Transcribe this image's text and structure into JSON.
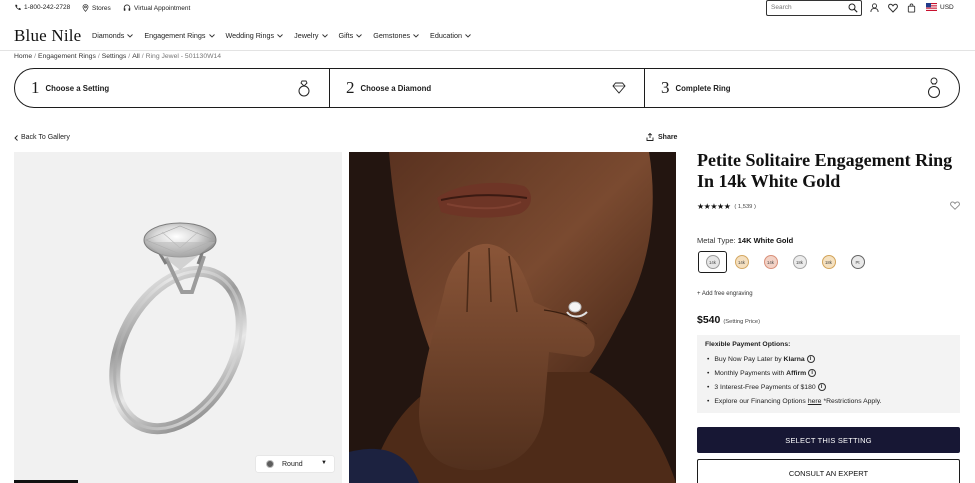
{
  "utility": {
    "phone": "1-800-242-2728",
    "stores": "Stores",
    "appointment": "Virtual Appointment",
    "search_placeholder": "Search",
    "currency": "USD"
  },
  "brand": {
    "logo": "Blue Nile"
  },
  "nav": {
    "items": [
      "Diamonds",
      "Engagement Rings",
      "Wedding Rings",
      "Jewelry",
      "Gifts",
      "Gemstones",
      "Education"
    ]
  },
  "breadcrumb": {
    "items": [
      "Home",
      "Engagement Rings",
      "Settings",
      "All"
    ],
    "current": "Ring Jewel - 501130W14"
  },
  "steps": [
    {
      "num": "1",
      "label": "Choose a Setting",
      "icon": "ring-icon"
    },
    {
      "num": "2",
      "label": "Choose a Diamond",
      "icon": "diamond-icon"
    },
    {
      "num": "3",
      "label": "Complete Ring",
      "icon": "ring-complete-icon"
    }
  ],
  "gallery": {
    "back_label": "Back To Gallery",
    "share_label": "Share",
    "shape_selector": "Round"
  },
  "product": {
    "title": "Petite Solitaire Engagement Ring In 14k White Gold",
    "review_count": "( 1,539 )",
    "metal_label": "Metal Type:",
    "metal_value": "14K White Gold",
    "metals": [
      {
        "label": "14k",
        "color": "#e6e6e6",
        "ring": "#9a9a9a"
      },
      {
        "label": "14k",
        "color": "#f4dfbf",
        "ring": "#d4a862"
      },
      {
        "label": "14k",
        "color": "#f2d2c6",
        "ring": "#d9907a"
      },
      {
        "label": "18k",
        "color": "#ececec",
        "ring": "#a6a6a6"
      },
      {
        "label": "18k",
        "color": "#f5e1c0",
        "ring": "#d2a45a"
      },
      {
        "label": "Pt",
        "color": "#e9e9e9",
        "ring": "#666666"
      }
    ],
    "engraving": "Add free engraving",
    "price": "$540",
    "price_note": "(Setting Price)"
  },
  "payment": {
    "title": "Flexible Payment Options:",
    "klarna_prefix": "Buy Now Pay Later by",
    "klarna": "Klarna",
    "affirm_prefix": "Monthly Payments with",
    "affirm": "Affirm",
    "interest_free": "3 Interest-Free Payments of $180",
    "explore_prefix": "Explore our Financing Options",
    "explore_link": "here",
    "explore_suffix": "*Restrictions Apply."
  },
  "actions": {
    "select": "SELECT THIS SETTING",
    "consult": "CONSULT AN EXPERT"
  },
  "colors": {
    "primary_button": "#171734",
    "panel": "#f3f3f3"
  }
}
